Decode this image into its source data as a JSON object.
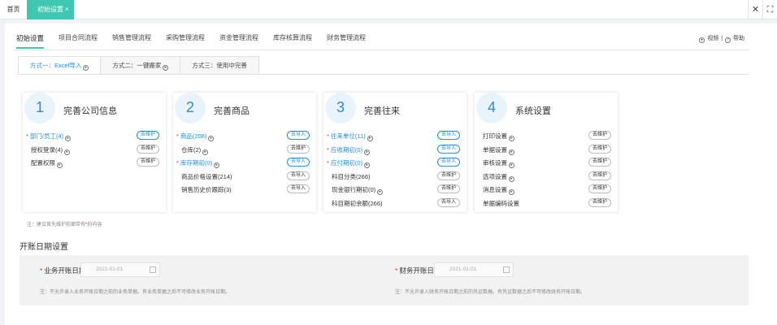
{
  "topbar": {
    "home_tab": "首页",
    "active_tab": "初始设置",
    "close_mark": "×",
    "right_icons": [
      "close-icon",
      "fullscreen-icon"
    ],
    "close_glyph": "✕",
    "fullscreen_glyph": "⛶"
  },
  "nav": {
    "tabs": [
      "初始设置",
      "项目合同流程",
      "销售管理流程",
      "采购管理流程",
      "资金管理流程",
      "库存核算流程",
      "财务管理流程"
    ],
    "video": "视频",
    "divider": "|",
    "help": "帮助"
  },
  "modes": [
    "方式一：Excel导入",
    "方式二：一键搬家",
    "方式三：使用中完善"
  ],
  "cards": [
    {
      "num": "1",
      "title": "完善公司信息",
      "rows": [
        {
          "label": "部门/员工(4)",
          "required": true,
          "link": true,
          "btn": "去维护",
          "btn_blue": true
        },
        {
          "label": "授权登录(4)",
          "required": false,
          "link": false,
          "btn": "去维护",
          "btn_blue": false
        },
        {
          "label": "配置权限",
          "required": false,
          "link": false,
          "btn": "去维护",
          "btn_blue": false
        }
      ]
    },
    {
      "num": "2",
      "title": "完善商品",
      "rows": [
        {
          "label": "商品(208)",
          "required": true,
          "link": true,
          "btn": "去导入",
          "btn_blue": true
        },
        {
          "label": "仓库(2)",
          "required": false,
          "link": false,
          "btn": "去维护",
          "btn_blue": false
        },
        {
          "label": "库存期初(0)",
          "required": true,
          "link": true,
          "btn": "去导入",
          "btn_blue": true
        },
        {
          "label": "商品价格设置(214)",
          "required": false,
          "link": false,
          "btn": "去导入",
          "btn_blue": false
        },
        {
          "label": "销售历史价跟踪(3)",
          "required": false,
          "link": false,
          "btn": "去导入",
          "btn_blue": false
        }
      ]
    },
    {
      "num": "3",
      "title": "完善往来",
      "rows": [
        {
          "label": "往来单位(11)",
          "required": true,
          "link": true,
          "btn": "去导入",
          "btn_blue": true
        },
        {
          "label": "应收期初(0)",
          "required": true,
          "link": true,
          "btn": "去导入",
          "btn_blue": true
        },
        {
          "label": "应付期初(0)",
          "required": true,
          "link": true,
          "btn": "去导入",
          "btn_blue": true
        },
        {
          "label": "科目分类(266)",
          "required": false,
          "link": false,
          "btn": "去维护",
          "btn_blue": false
        },
        {
          "label": "现金银行期初(0)",
          "required": false,
          "link": false,
          "btn": "去维护",
          "btn_blue": false
        },
        {
          "label": "科目期初余额(266)",
          "required": false,
          "link": false,
          "btn": "去导入",
          "btn_blue": false
        }
      ]
    },
    {
      "num": "4",
      "title": "系统设置",
      "rows": [
        {
          "label": "打印设置",
          "required": false,
          "link": false,
          "btn": "去维护",
          "btn_blue": false
        },
        {
          "label": "单据设置",
          "required": false,
          "link": false,
          "btn": "去维护",
          "btn_blue": false
        },
        {
          "label": "审核设置",
          "required": false,
          "link": false,
          "btn": "去维护",
          "btn_blue": false
        },
        {
          "label": "选项设置",
          "required": false,
          "link": false,
          "btn": "去维护",
          "btn_blue": false
        },
        {
          "label": "消息设置",
          "required": false,
          "link": false,
          "btn": "去维护",
          "btn_blue": false
        },
        {
          "label": "单据编码设置",
          "required": false,
          "link": false,
          "btn": "去维护",
          "btn_blue": false
        }
      ]
    }
  ],
  "note": {
    "prefix": "注：建议首先维护前面带有",
    "star": "*",
    "suffix": "的内容"
  },
  "dates": {
    "title": "开账日期设置",
    "star": "*",
    "business_label": "业务开账日期",
    "business_value": "2021-01-01",
    "business_note": "注：不允许录入业务开账日期之前的业务单据。有业务单据之后不可修改业务开账日期。",
    "finance_label": "财务开账日期",
    "finance_value": "2021-01-01",
    "finance_note": "注：不允许录入财务开账日期之前的凭证数据。有凭证数据之后不可修改财务开账日期。"
  },
  "colors": {
    "accent": "#3fc7b2",
    "link": "#1e8ee6",
    "required": "#e33333"
  }
}
